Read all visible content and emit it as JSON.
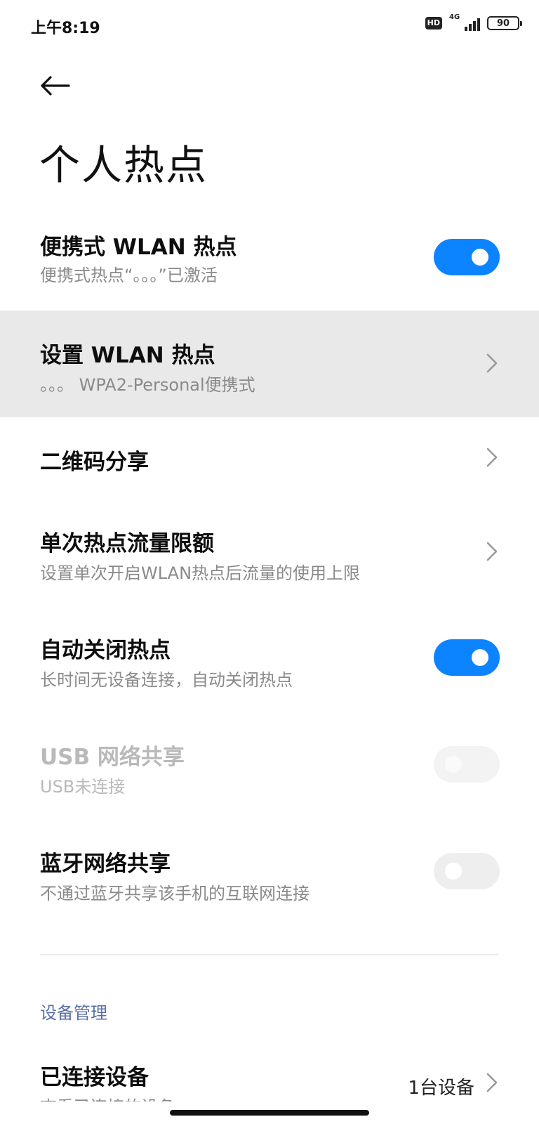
{
  "status_bar": {
    "time": "上午8:19",
    "hd": "HD",
    "network": "4G",
    "battery": "90"
  },
  "page": {
    "back_icon": "arrow-left-icon",
    "title": "个人热点"
  },
  "settings": [
    {
      "title": "便携式 WLAN 热点",
      "subtitle": "便携式热点“。。。”已激活",
      "control": "toggle",
      "on": true
    },
    {
      "title": "设置 WLAN 热点",
      "subtitle": "。。。 WPA2-Personal便携式",
      "control": "chevron"
    },
    {
      "title": "二维码分享",
      "control": "chevron"
    },
    {
      "title": "单次热点流量限额",
      "subtitle": "设置单次开启WLAN热点后流量的使用上限",
      "control": "chevron"
    },
    {
      "title": "自动关闭热点",
      "subtitle": "长时间无设备连接，自动关闭热点",
      "control": "toggle",
      "on": true
    },
    {
      "title": "USB 网络共享",
      "subtitle": "USB未连接",
      "control": "toggle",
      "on": false,
      "disabled": true
    },
    {
      "title": "蓝牙网络共享",
      "subtitle": "不通过蓝牙共享该手机的互联网连接",
      "control": "toggle",
      "on": false
    }
  ],
  "device_section": {
    "header": "设备管理",
    "connected_title": "已连接设备",
    "connected_subtitle": "查看已连接的设备",
    "connected_value": "1台设备"
  },
  "colors": {
    "accent": "#0d84ff",
    "highlight_row": "#e9e9e9",
    "section_header": "#5a6fa6"
  }
}
